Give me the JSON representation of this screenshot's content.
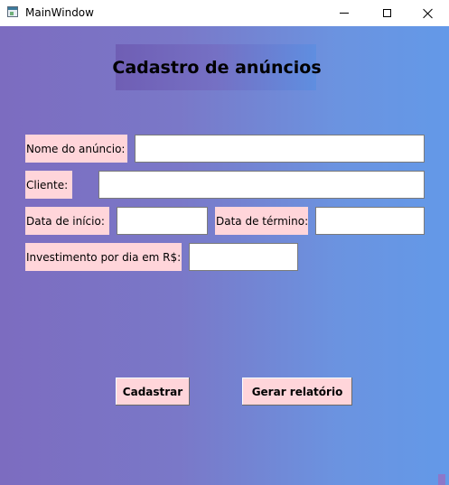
{
  "window": {
    "title": "MainWindow"
  },
  "heading": "Cadastro de anúncios",
  "form": {
    "nome_label": "Nome do anúncio:",
    "nome_value": "",
    "cliente_label": "Cliente:",
    "cliente_value": "",
    "inicio_label": "Data de início:",
    "inicio_value": "",
    "termino_label": "Data de término:",
    "termino_value": "",
    "investimento_label": "Investimento por dia em R$:",
    "investimento_value": ""
  },
  "buttons": {
    "cadastrar": "Cadastrar",
    "gerar_relatorio": "Gerar relatório"
  },
  "colors": {
    "label_bg": "#ffd5da",
    "gradient_start": "#7c6cc0",
    "gradient_end": "#6399e8"
  },
  "icons": {
    "app": "app-window-icon",
    "minimize": "minimize-icon",
    "maximize": "maximize-icon",
    "close": "close-icon"
  }
}
